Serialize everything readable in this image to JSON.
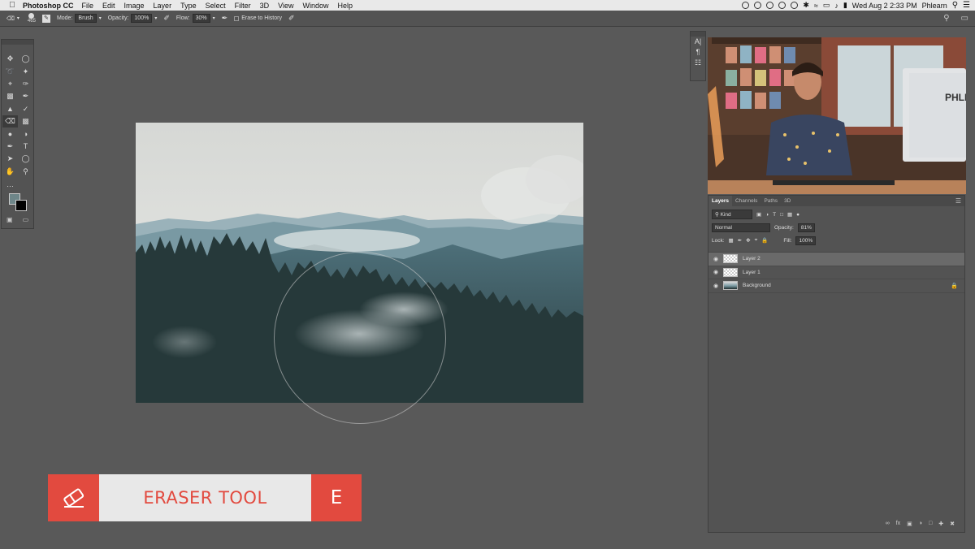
{
  "menubar": {
    "app_name": "Photoshop CC",
    "items": [
      "File",
      "Edit",
      "Image",
      "Layer",
      "Type",
      "Select",
      "Filter",
      "3D",
      "View",
      "Window",
      "Help"
    ],
    "datetime": "Wed Aug 2  2:33 PM",
    "user": "Phlearn"
  },
  "options": {
    "brush_size": "465",
    "mode_label": "Mode:",
    "mode_value": "Brush",
    "opacity_label": "Opacity:",
    "opacity_value": "100%",
    "flow_label": "Flow:",
    "flow_value": "30%",
    "erase_history_label": "Erase to History"
  },
  "lower_third": {
    "label": "ERASER TOOL",
    "shortcut": "E"
  },
  "layers_panel": {
    "tabs": [
      "Layers",
      "Channels",
      "Paths",
      "3D"
    ],
    "filter_kind": "Kind",
    "blend_mode": "Normal",
    "opacity_label": "Opacity:",
    "opacity_value": "81%",
    "lock_label": "Lock:",
    "fill_label": "Fill:",
    "fill_value": "100%",
    "layers": [
      {
        "name": "Layer 2",
        "selected": true
      },
      {
        "name": "Layer 1",
        "selected": false
      },
      {
        "name": "Background",
        "selected": false
      }
    ]
  },
  "colors": {
    "accent": "#e24a3f",
    "foreground": "#6e8689",
    "background": "#000000"
  }
}
